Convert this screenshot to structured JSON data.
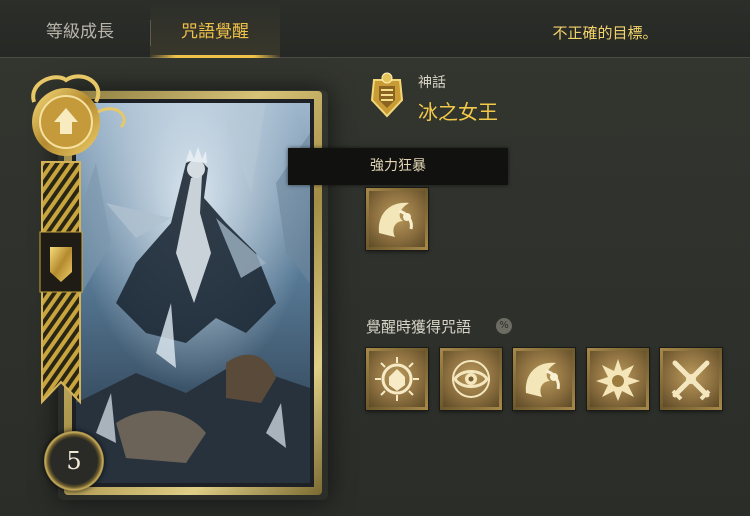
{
  "tabs": [
    {
      "label": "等級成長",
      "active": false
    },
    {
      "label": "咒語覺醒",
      "active": true
    }
  ],
  "error_message": "不正確的目標。",
  "card": {
    "rank": "神話",
    "name": "冰之女王",
    "level": "5"
  },
  "tooltip": {
    "text": "強力狂暴"
  },
  "current_skill": {
    "icon": "berserk-skill-icon"
  },
  "awakening": {
    "title": "覺醒時獲得咒語",
    "info_icon": "percent-info-icon",
    "skills": [
      {
        "icon": "sun-shield-skill-icon"
      },
      {
        "icon": "eye-skill-icon"
      },
      {
        "icon": "berserk-skill-icon"
      },
      {
        "icon": "explosion-skill-icon"
      },
      {
        "icon": "crossed-swords-skill-icon"
      }
    ]
  },
  "colors": {
    "accent_gold": "#f0c24a",
    "error_text": "#f2d36a",
    "background": "#2f312e"
  }
}
